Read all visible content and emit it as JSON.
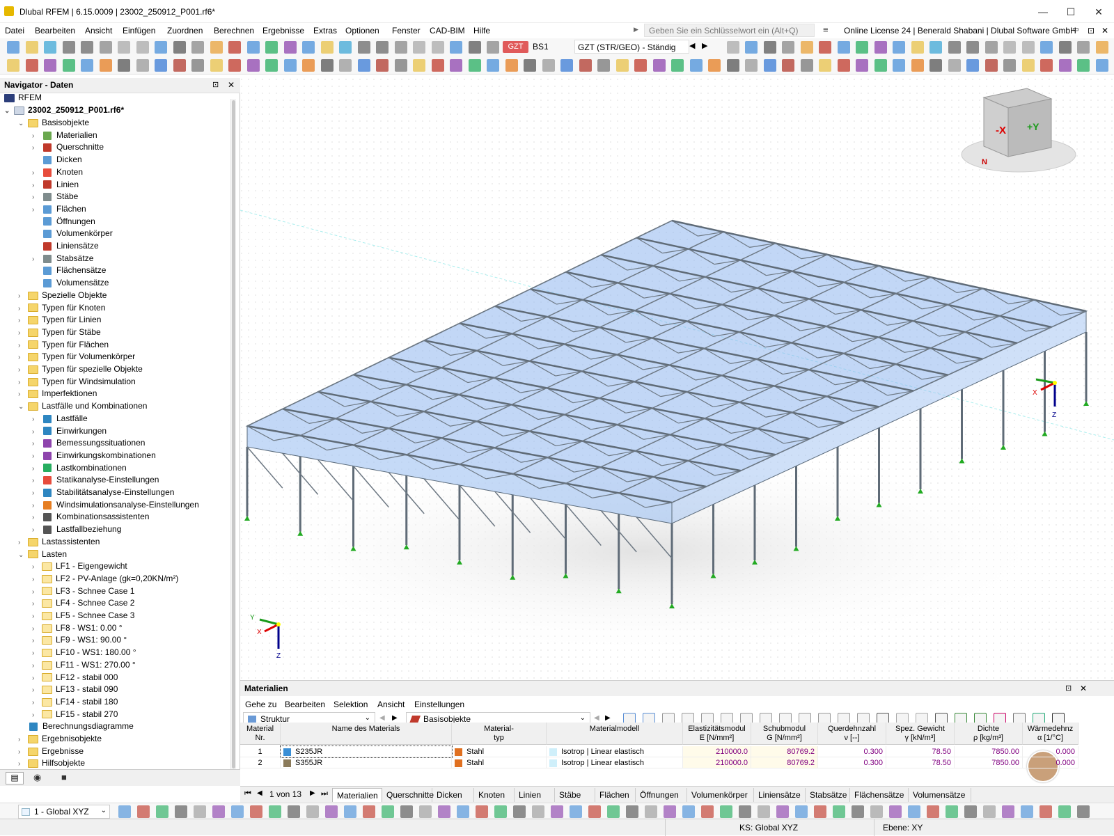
{
  "window": {
    "title": "Dlubal RFEM | 6.15.0009 | 23002_250912_P001.rf6*",
    "minimize": "—",
    "maximize": "☐",
    "close": "✕"
  },
  "menu": [
    "Datei",
    "Bearbeiten",
    "Ansicht",
    "Einfügen",
    "Zuordnen",
    "Berechnen",
    "Ergebnisse",
    "Extras",
    "Optionen",
    "Fenster",
    "CAD-BIM",
    "Hilfe"
  ],
  "search": {
    "placeholder": "Geben Sie ein Schlüsselwort ein (Alt+Q)"
  },
  "license": "Online License 24 | Benerald Shabani | Dlubal Software GmbH",
  "toolbar": {
    "gzt": "GZT",
    "bs": "BS1",
    "combo": "GZT (STR/GEO) - Ständig u..."
  },
  "navigator": {
    "title": "Navigator - Daten",
    "root": "RFEM",
    "file": "23002_250912_P001.rf6*",
    "items": [
      {
        "label": "Basisobjekte",
        "level": 1,
        "open": true
      },
      {
        "label": "Materialien",
        "level": 2,
        "color": "#6aa84f"
      },
      {
        "label": "Querschnitte",
        "level": 2,
        "color": "#c0392b"
      },
      {
        "label": "Dicken",
        "level": 2,
        "color": "#5b9bd5",
        "leaf": true
      },
      {
        "label": "Knoten",
        "level": 2,
        "color": "#e74c3c"
      },
      {
        "label": "Linien",
        "level": 2,
        "color": "#c0392b"
      },
      {
        "label": "Stäbe",
        "level": 2,
        "color": "#7f8c8d"
      },
      {
        "label": "Flächen",
        "level": 2,
        "color": "#5b9bd5"
      },
      {
        "label": "Öffnungen",
        "level": 2,
        "color": "#5b9bd5",
        "leaf": true
      },
      {
        "label": "Volumenkörper",
        "level": 2,
        "color": "#5b9bd5",
        "leaf": true
      },
      {
        "label": "Liniensätze",
        "level": 2,
        "color": "#c0392b",
        "leaf": true
      },
      {
        "label": "Stabsätze",
        "level": 2,
        "color": "#7f8c8d"
      },
      {
        "label": "Flächensätze",
        "level": 2,
        "color": "#5b9bd5",
        "leaf": true
      },
      {
        "label": "Volumensätze",
        "level": 2,
        "color": "#5b9bd5",
        "leaf": true
      },
      {
        "label": "Spezielle Objekte",
        "level": 1
      },
      {
        "label": "Typen für Knoten",
        "level": 1
      },
      {
        "label": "Typen für Linien",
        "level": 1
      },
      {
        "label": "Typen für Stäbe",
        "level": 1
      },
      {
        "label": "Typen für Flächen",
        "level": 1
      },
      {
        "label": "Typen für Volumenkörper",
        "level": 1
      },
      {
        "label": "Typen für spezielle Objekte",
        "level": 1
      },
      {
        "label": "Typen für Windsimulation",
        "level": 1
      },
      {
        "label": "Imperfektionen",
        "level": 1
      },
      {
        "label": "Lastfälle und Kombinationen",
        "level": 1,
        "open": true
      },
      {
        "label": "Lastfälle",
        "level": 2,
        "color": "#2e86c1"
      },
      {
        "label": "Einwirkungen",
        "level": 2,
        "color": "#2e86c1"
      },
      {
        "label": "Bemessungssituationen",
        "level": 2,
        "color": "#8e44ad"
      },
      {
        "label": "Einwirkungskombinationen",
        "level": 2,
        "color": "#8e44ad"
      },
      {
        "label": "Lastkombinationen",
        "level": 2,
        "color": "#27ae60"
      },
      {
        "label": "Statikanalyse-Einstellungen",
        "level": 2,
        "color": "#e74c3c"
      },
      {
        "label": "Stabilitätsanalyse-Einstellungen",
        "level": 2,
        "color": "#2e86c1"
      },
      {
        "label": "Windsimulationsanalyse-Einstellungen",
        "level": 2,
        "color": "#e67e22"
      },
      {
        "label": "Kombinationsassistenten",
        "level": 2,
        "color": "#555555"
      },
      {
        "label": "Lastfallbeziehung",
        "level": 2,
        "color": "#555555"
      },
      {
        "label": "Lastassistenten",
        "level": 1
      },
      {
        "label": "Lasten",
        "level": 1,
        "open": true
      },
      {
        "label": "LF1 - Eigengewicht",
        "level": 2,
        "folder": true
      },
      {
        "label": "LF2 - PV-Anlage (gk=0,20KN/m²)",
        "level": 2,
        "folder": true
      },
      {
        "label": "LF3 - Schnee Case 1",
        "level": 2,
        "folder": true
      },
      {
        "label": "LF4 - Schnee Case 2",
        "level": 2,
        "folder": true
      },
      {
        "label": "LF5 - Schnee Case 3",
        "level": 2,
        "folder": true
      },
      {
        "label": "LF8 - WS1: 0.00 °",
        "level": 2,
        "folder": true
      },
      {
        "label": "LF9 - WS1: 90.00 °",
        "level": 2,
        "folder": true
      },
      {
        "label": "LF10 - WS1: 180.00 °",
        "level": 2,
        "folder": true
      },
      {
        "label": "LF11 - WS1: 270.00 °",
        "level": 2,
        "folder": true
      },
      {
        "label": "LF12 - stabil 000",
        "level": 2,
        "folder": true
      },
      {
        "label": "LF13 - stabil 090",
        "level": 2,
        "folder": true
      },
      {
        "label": "LF14 - stabil 180",
        "level": 2,
        "folder": true
      },
      {
        "label": "LF15 - stabil 270",
        "level": 2,
        "folder": true
      },
      {
        "label": "Berechnungsdiagramme",
        "level": 1,
        "leaf": true,
        "color": "#2e86c1"
      },
      {
        "label": "Ergebnisobjekte",
        "level": 1
      },
      {
        "label": "Ergebnisse",
        "level": 1
      },
      {
        "label": "Hilfsobjekte",
        "level": 1
      }
    ]
  },
  "viewport": {
    "cube_x": "-X",
    "cube_y": "+Y",
    "cube_n": "N",
    "axis_x": "X",
    "axis_y": "Y",
    "axis_z": "Z"
  },
  "panel": {
    "title": "Materialien",
    "menu": [
      "Gehe zu",
      "Bearbeiten",
      "Selektion",
      "Ansicht",
      "Einstellungen"
    ],
    "struct": "Struktur",
    "basis": "Basisobjekte",
    "columns": [
      {
        "l1": "Material",
        "l2": "Nr."
      },
      {
        "l1": "",
        "l2": "Name des Materials"
      },
      {
        "l1": "Material-",
        "l2": "typ"
      },
      {
        "l1": "",
        "l2": "Materialmodell"
      },
      {
        "l1": "Elastizitätsmodul",
        "l2": "E [N/mm²]"
      },
      {
        "l1": "Schubmodul",
        "l2": "G [N/mm²]"
      },
      {
        "l1": "Querdehnzahl",
        "l2": "ν [--]"
      },
      {
        "l1": "Spez. Gewicht",
        "l2": "γ [kN/m³]"
      },
      {
        "l1": "Dichte",
        "l2": "ρ [kg/m³]"
      },
      {
        "l1": "Wärmedehnz",
        "l2": "α [1/°C]"
      }
    ],
    "rows": [
      {
        "nr": "1",
        "name": "S235JR",
        "color": "#3a8fd6",
        "typ": "Stahl",
        "model": "Isotrop | Linear elastisch",
        "e": "210000.0",
        "g": "80769.2",
        "nu": "0.300",
        "gamma": "78.50",
        "rho": "7850.00",
        "alpha": "0.000"
      },
      {
        "nr": "2",
        "name": "S355JR",
        "color": "#8a7a5a",
        "typ": "Stahl",
        "model": "Isotrop | Linear elastisch",
        "e": "210000.0",
        "g": "80769.2",
        "nu": "0.300",
        "gamma": "78.50",
        "rho": "7850.00",
        "alpha": "0.000"
      }
    ],
    "pager": "1 von 13",
    "tabs": [
      "Materialien",
      "Querschnitte",
      "Dicken",
      "Knoten",
      "Linien",
      "Stäbe",
      "Flächen",
      "Öffnungen",
      "Volumenkörper",
      "Liniensätze",
      "Stabsätze",
      "Flächensätze",
      "Volumensätze"
    ]
  },
  "bottom": {
    "cs": "1 - Global XYZ"
  },
  "status": {
    "ks": "KS: Global XYZ",
    "ebene": "Ebene: XY"
  }
}
